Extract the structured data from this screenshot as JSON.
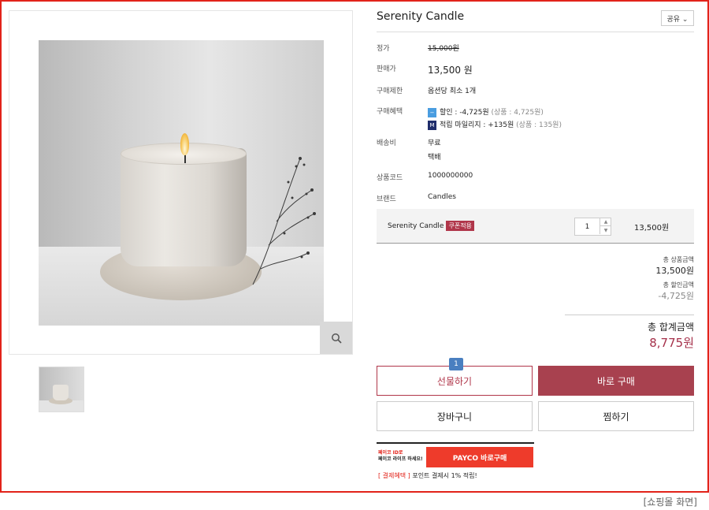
{
  "product": {
    "title": "Serenity Candle",
    "share_label": "공유 ⌄"
  },
  "info": {
    "list_price_label": "정가",
    "list_price": "15,000원",
    "sale_price_label": "판매가",
    "sale_price": "13,500 원",
    "purchase_limit_label": "구매제한",
    "purchase_limit": "옵션당 최소 1개",
    "benefit_label": "구매혜택",
    "discount_badge": "−",
    "discount_text": "할인 : -4,725원",
    "discount_detail": "(상품 : 4,725원)",
    "mileage_badge": "M",
    "mileage_text": "적립 마일리지 : +135원",
    "mileage_detail": "(상품 : 135원)",
    "shipping_label": "배송비",
    "shipping_value": "무료",
    "shipping_method": "택배",
    "product_code_label": "상품코드",
    "product_code": "1000000000",
    "brand_label": "브랜드",
    "brand": "Candles"
  },
  "option": {
    "name": "Serenity Candle",
    "coupon_tag": "쿠폰적용",
    "quantity": "1",
    "price": "13,500원"
  },
  "summary": {
    "product_total_label": "총 상품금액",
    "product_total": "13,500원",
    "discount_total_label": "총 할인금액",
    "discount_total": "-4,725원",
    "grand_total_label": "총 합계금액",
    "grand_total": "8,775원"
  },
  "buttons": {
    "step_badge": "1",
    "gift": "선물하기",
    "buy_now": "바로 구매",
    "cart": "장바구니",
    "wishlist": "찜하기"
  },
  "payco": {
    "line1": "페이코 ID로",
    "line2": "페이코 라이프 하세요!",
    "button": "PAYCO 바로구매",
    "note_tag": "[ 결제혜택 ]",
    "note_text": "포인트 결제시 1% 적립!"
  },
  "caption": "[쇼핑몰 화면]",
  "colors": {
    "accent": "#a8414f",
    "frame": "#e2231a",
    "payco": "#ee3b2b"
  }
}
